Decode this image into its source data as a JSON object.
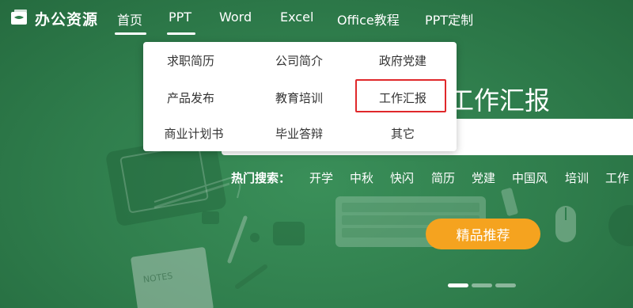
{
  "logo": {
    "text": "办公资源",
    "icon": "logo-icon"
  },
  "nav": {
    "items": [
      {
        "label": "首页",
        "active": true
      },
      {
        "label": "PPT",
        "active": true
      },
      {
        "label": "Word",
        "active": false
      },
      {
        "label": "Excel",
        "active": false
      },
      {
        "label": "Office教程",
        "active": false
      },
      {
        "label": "PPT定制",
        "active": false
      }
    ]
  },
  "dropdown": {
    "items": [
      "求职简历",
      "公司简介",
      "政府党建",
      "产品发布",
      "教育培训",
      "工作汇报",
      "商业计划书",
      "毕业答辩",
      "其它"
    ],
    "highlighted": "工作汇报",
    "highlight_color": "#e0282b"
  },
  "hero": {
    "title": "工作汇报",
    "hot_search_label": "热门搜索：",
    "hot_terms": [
      "开学",
      "中秋",
      "快闪",
      "简历",
      "党建",
      "中国风",
      "培训",
      "工作"
    ],
    "featured_button": "精品推荐",
    "slide_count": 3,
    "active_slide": 1
  },
  "colors": {
    "background": "#2f7d4c",
    "accent_button": "#f5a31f",
    "dropdown_text": "#333333"
  }
}
